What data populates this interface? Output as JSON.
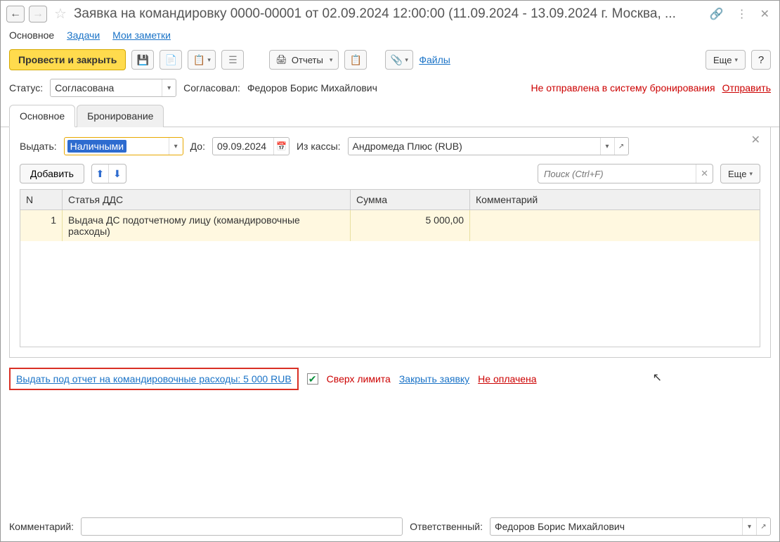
{
  "header": {
    "title": "Заявка на командировку 0000-00001  от 02.09.2024 12:00:00 (11.09.2024 - 13.09.2024 г. Москва, ..."
  },
  "tabs1": {
    "main": "Основное",
    "tasks": "Задачи",
    "notes": "Мои заметки"
  },
  "toolbar": {
    "post_close": "Провести и закрыть",
    "reports": "Отчеты",
    "files": "Файлы",
    "more": "Еще",
    "help": "?"
  },
  "status": {
    "label": "Статус:",
    "value": "Согласована",
    "approved_by_label": "Согласовал:",
    "approved_by": "Федоров Борис Михайлович",
    "warning": "Не отправлена в систему бронирования",
    "send": "Отправить"
  },
  "tabs2": {
    "main": "Основное",
    "booking": "Бронирование"
  },
  "panel": {
    "pay_label": "Выдать:",
    "pay_value": "Наличными",
    "until_label": "До:",
    "until_value": "09.09.2024",
    "cash_label": "Из кассы:",
    "cash_value": "Андромеда Плюс (RUB)",
    "add": "Добавить",
    "search_placeholder": "Поиск (Ctrl+F)",
    "more": "Еще"
  },
  "grid": {
    "headers": {
      "n": "N",
      "article": "Статья ДДС",
      "sum": "Сумма",
      "comment": "Комментарий"
    },
    "rows": [
      {
        "n": "1",
        "article": "Выдача ДС подотчетному лицу (командировочные расходы)",
        "sum": "5 000,00",
        "comment": ""
      }
    ]
  },
  "links": {
    "issue": "Выдать под отчет на командировочные расходы: 5 000 RUB",
    "over_limit": "Сверх лимита",
    "close_req": "Закрыть заявку",
    "not_paid": "Не оплачена"
  },
  "footer": {
    "comment_label": "Комментарий:",
    "responsible_label": "Ответственный:",
    "responsible_value": "Федоров Борис Михайлович"
  }
}
